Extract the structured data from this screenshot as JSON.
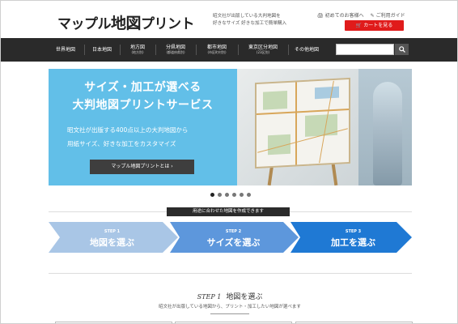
{
  "header": {
    "logo_a": "マップル",
    "logo_b": "地図",
    "logo_c": "プリント",
    "tagline_line1": "昭文社が出版している大判地図を",
    "tagline_line2": "好きなサイズ 好きな加工で簡単購入",
    "link_first": "初めてのお客様へ",
    "link_guide": "ご利用ガイド",
    "cart_label": "カートを見る"
  },
  "nav": {
    "items": [
      {
        "label": "世界地図",
        "sub": ""
      },
      {
        "label": "日本地図",
        "sub": ""
      },
      {
        "label": "地方図",
        "sub": "(地方別)"
      },
      {
        "label": "分県地図",
        "sub": "(都道府県別)"
      },
      {
        "label": "都市地図",
        "sub": "(市区町村別)"
      },
      {
        "label": "東京区分地図",
        "sub": "(23区別)"
      },
      {
        "label": "その他地図",
        "sub": ""
      }
    ],
    "search_placeholder": ""
  },
  "hero": {
    "title_line1": "サイズ・加工が選べる",
    "title_line2": "大判地図プリントサービス",
    "desc_line1": "昭文社が出版する400点以上の大判地図から",
    "desc_line2": "用紙サイズ、好きな加工をカスタマイズ",
    "button_label": "マップル地図プリントとは  ›"
  },
  "carousel": {
    "count": 6,
    "active": 0
  },
  "steps": {
    "heading": "用途に合わせた地図を作成できます",
    "items": [
      {
        "num": "STEP 1",
        "label": "地図を選ぶ",
        "color": "#a9c6e6"
      },
      {
        "num": "STEP 2",
        "label": "サイズを選ぶ",
        "color": "#5d97dc"
      },
      {
        "num": "STEP 3",
        "label": "加工を選ぶ",
        "color": "#1f79d4"
      }
    ]
  },
  "section": {
    "step_tag": "STEP 1",
    "title": "地図を選ぶ",
    "subtitle": "昭文社が出版している地図から、プリント・加工したい地図が選べます"
  },
  "colors": {
    "nav_bg": "#2a2a2a",
    "cart_red": "#e01b1b",
    "hero_blue": "#62bfe8"
  }
}
